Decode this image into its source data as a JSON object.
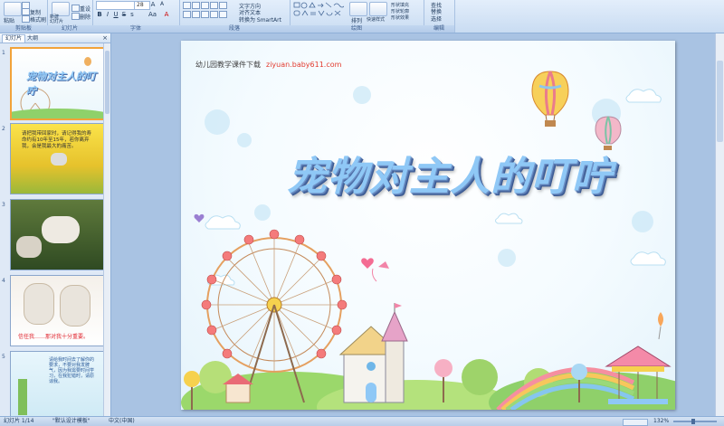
{
  "ribbon": {
    "groups": {
      "clipboard": "剪贴板",
      "slides": "幻灯片",
      "font": "字体",
      "paragraph": "段落",
      "drawing": "绘图",
      "editing": "编辑"
    },
    "paste": "粘贴",
    "copy": "复制",
    "format_painter": "格式刷",
    "new_slide": "新建\n幻灯片",
    "reset": "重设",
    "delete": "删除",
    "font_size": "28",
    "text_direction": "文字方向",
    "align_text": "对齐文本",
    "convert_smartart": "转换为 SmartArt",
    "arrange": "排列",
    "quick_styles": "快速样式",
    "shape_fill": "形状填充",
    "shape_outline": "形状轮廓",
    "shape_effects": "形状效果",
    "find": "查找",
    "replace": "替换",
    "select": "选择"
  },
  "pane": {
    "tab_slides": "幻灯片",
    "tab_outline": "大纲",
    "close": "×",
    "thumbs": [
      {
        "num": "1",
        "text": "宠物对主人的叮咛"
      },
      {
        "num": "2",
        "text": "请把我带回家时，请记得我的寿命约有10年至15年，若你离弃我，会是我最大的痛苦。"
      },
      {
        "num": "3",
        "text": ""
      },
      {
        "num": "4",
        "text": "信任我……那对我十分重要。"
      },
      {
        "num": "5",
        "text": "请给我时间去了解你的要求，不要对我发脾气，因为我需要时间学习，在我犯错时，请原谅我。"
      }
    ]
  },
  "slide": {
    "header_label": "幼儿园教学课件下载",
    "header_url": "ziyuan.baby611.com",
    "title": "宠物对主人的叮咛"
  },
  "status": {
    "slide_info": "幻灯片 1/14",
    "theme": "\"默认设计模板\"",
    "language": "中文(中国)",
    "zoom": "132%"
  },
  "colors": {
    "title_fill": "#8fc8f6",
    "title_shadow": "#4e6fa8",
    "url": "#e23b2e",
    "selection": "#f2a33a"
  }
}
